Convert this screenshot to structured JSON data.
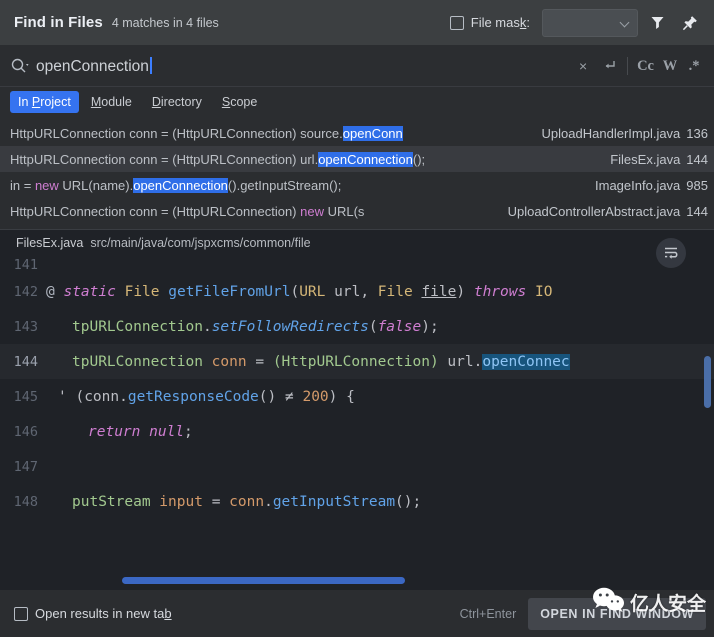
{
  "header": {
    "title": "Find in Files",
    "match_info": "4 matches in 4 files",
    "file_mask_label_pre": "File mas",
    "file_mask_label_mnemonic": "k",
    "file_mask_label_post": ":",
    "file_mask_value": "",
    "filter_icon": "funnel-icon",
    "pin_icon": "pin-icon"
  },
  "search": {
    "icon": "search-icon",
    "value": "openConnection",
    "placeholder": "",
    "clear_label": "×",
    "newline_icon": "new-line-icon",
    "toggles": [
      {
        "name": "match-case",
        "label": "Cc"
      },
      {
        "name": "words",
        "label": "W"
      },
      {
        "name": "regex",
        "label": ".*"
      }
    ]
  },
  "scope_tabs": [
    {
      "name": "in-project",
      "pre": "In ",
      "mnemonic": "P",
      "post": "roject",
      "active": true
    },
    {
      "name": "module",
      "pre": "",
      "mnemonic": "M",
      "post": "odule",
      "active": false
    },
    {
      "name": "directory",
      "pre": "",
      "mnemonic": "D",
      "post": "irectory",
      "active": false
    },
    {
      "name": "scope",
      "pre": "",
      "mnemonic": "S",
      "post": "cope",
      "active": false
    }
  ],
  "results": [
    {
      "pre": "HttpURLConnection conn = (HttpURLConnection) source.",
      "match": "openConn",
      "post": "",
      "keyword": "",
      "file": "UploadHandlerImpl.java",
      "line": "136",
      "selected": false
    },
    {
      "pre": "HttpURLConnection conn = (HttpURLConnection) url.",
      "match": "openConnection",
      "post": "();",
      "keyword": "",
      "file": "FilesEx.java",
      "line": "144",
      "selected": true
    },
    {
      "pre": "in = ",
      "keyword": "new",
      "pre2": " URL(name).",
      "match": "openConnection",
      "post": "().getInputStream();",
      "file": "ImageInfo.java",
      "line": "985",
      "selected": false
    },
    {
      "pre": "HttpURLConnection conn = (HttpURLConnection) ",
      "keyword": "new",
      "pre2": " URL(s",
      "match": "",
      "post": "",
      "file": "UploadControllerAbstract.java",
      "line": "144",
      "selected": false
    }
  ],
  "preview": {
    "file_name": "FilesEx.java",
    "file_path": "src/main/java/com/jspxcms/common/file",
    "wrap_icon": "soft-wrap-icon",
    "lines": [
      {
        "num": "141",
        "current": false
      },
      {
        "num": "142",
        "current": false
      },
      {
        "num": "143",
        "current": false
      },
      {
        "num": "144",
        "current": true
      },
      {
        "num": "145",
        "current": false
      },
      {
        "num": "146",
        "current": false
      },
      {
        "num": "147",
        "current": false
      },
      {
        "num": "148",
        "current": false
      }
    ],
    "code": {
      "l142_at": "@",
      "l142_static": "static",
      "l142_file": "File",
      "l142_fn": "getFileFromUrl",
      "l142_open": "(",
      "l142_url": "URL",
      "l142_urlvar": " url, ",
      "l142_file2": "File",
      "l142_param": "file",
      "l142_close": ") ",
      "l142_throws": "throws",
      "l142_io": " IO",
      "l143_cls": "tpURLConnection",
      "l143_dot": ".",
      "l143_fn": "setFollowRedirects",
      "l143_open": "(",
      "l143_false": "false",
      "l143_close": ");",
      "l144_cls": "tpURLConnection",
      "l144_conn": " conn",
      "l144_eq": " = ",
      "l144_cast": "(HttpURLConnection)",
      "l144_url": " url.",
      "l144_hl": "openConnec",
      "l145_quote": "'",
      "l145_open": " (conn.",
      "l145_fn": "getResponseCode",
      "l145_paren": "() ",
      "l145_neq": "≠",
      "l145_num": " 200",
      "l145_close": ") {",
      "l146_return": "return",
      "l146_null": " null",
      "l146_semi": ";",
      "l148_cls": "putStream",
      "l148_var": " input",
      "l148_eq": " = ",
      "l148_conn": "conn",
      "l148_dot": ".",
      "l148_fn": "getInputStream",
      "l148_close": "();"
    }
  },
  "footer": {
    "open_new_tab_pre": "Open results in new ta",
    "open_new_tab_mnemonic": "b",
    "shortcut": "Ctrl+Enter",
    "primary_button": "OPEN IN FIND WINDOW"
  },
  "watermark": {
    "logo": "wechat-logo-icon",
    "text": "亿人安全"
  },
  "colors": {
    "accent_blue": "#3573f0",
    "match_highlight": "#2f6ee8",
    "preview_highlight": "#17547c",
    "header_bg": "#3c3f41",
    "body_bg": "#2b2d30",
    "code_bg": "#1f2227"
  }
}
